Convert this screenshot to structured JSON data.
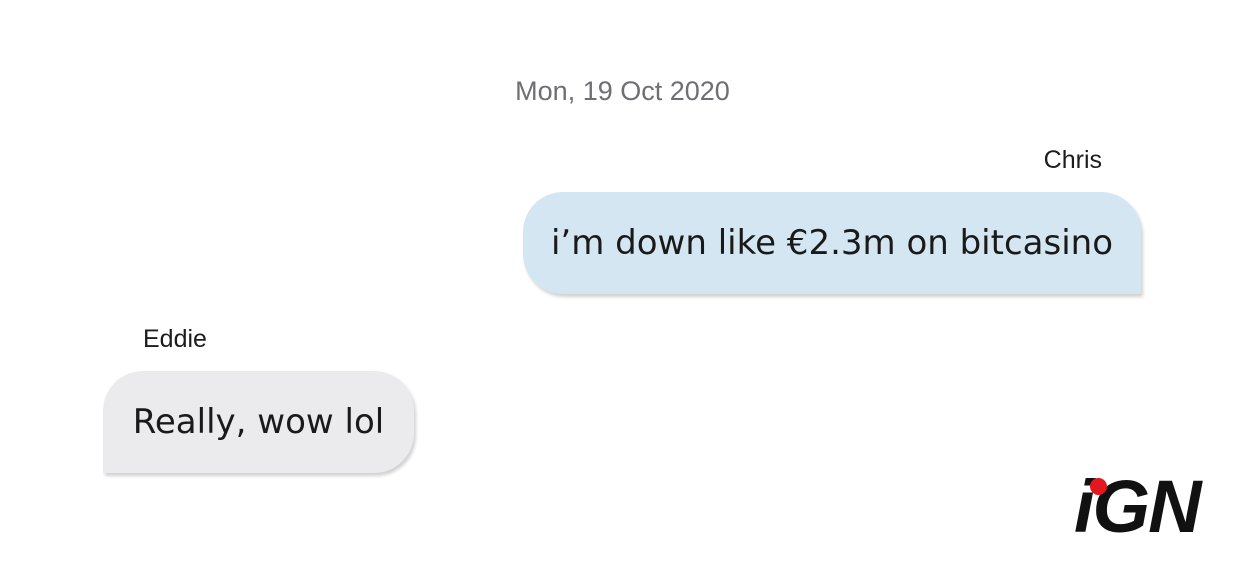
{
  "conversation": {
    "date": "Mon, 19 Oct 2020",
    "messages": [
      {
        "sender": "Chris",
        "text": "i’m down like €2.3m on bitcasino",
        "side": "right"
      },
      {
        "sender": "Eddie",
        "text": "Really, wow lol",
        "side": "left"
      }
    ]
  },
  "logo": {
    "text": "iGN",
    "dot_color": "#e3181e"
  },
  "colors": {
    "outgoing_bubble": "#d4e6f1",
    "incoming_bubble": "#ebebed",
    "date_text": "#6e6e73"
  }
}
